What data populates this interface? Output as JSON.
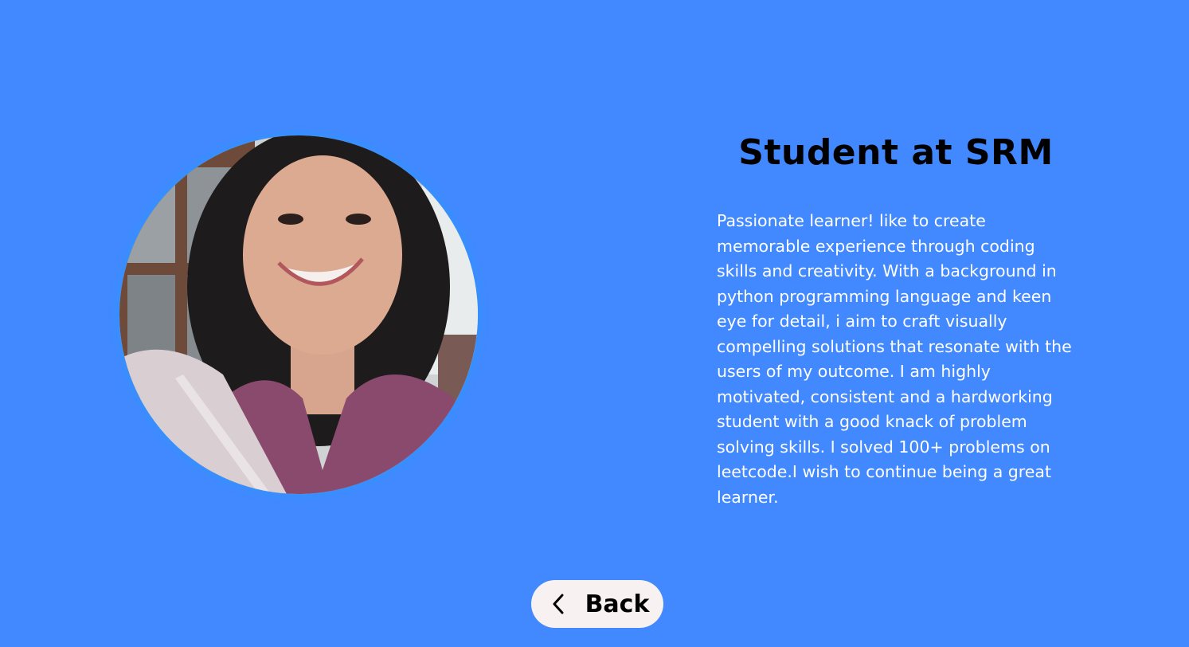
{
  "profile": {
    "photo_description": "circular profile photo"
  },
  "header": {
    "title": "Student at SRM"
  },
  "bio": {
    "text": "Passionate learner! like to create memorable experience through coding skills and creativity. With a background in python programming language and keen eye for detail, i aim to craft visually compelling solutions that resonate with the users of my outcome. I am highly motivated, consistent and a hardworking student with a good knack of problem solving skills. I solved 100+ problems on leetcode.I wish to continue being a great learner."
  },
  "navigation": {
    "back_label": "Back",
    "back_icon": "chevron-left-icon"
  },
  "colors": {
    "background": "#4289ff",
    "button_background": "#f7f1f1",
    "title_text": "#000000",
    "body_text": "#ffffff"
  }
}
